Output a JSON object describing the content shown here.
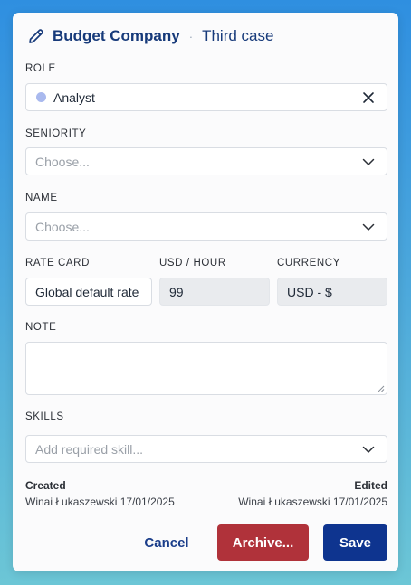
{
  "header": {
    "title": "Budget Company",
    "separator": "·",
    "subtitle": "Third case"
  },
  "role": {
    "label": "ROLE",
    "value": "Analyst",
    "dot_color": "#a9b9ee"
  },
  "seniority": {
    "label": "SENIORITY",
    "placeholder": "Choose..."
  },
  "name": {
    "label": "NAME",
    "placeholder": "Choose..."
  },
  "rate_card": {
    "label": "RATE CARD",
    "value": "Global default rate"
  },
  "usd_hour": {
    "label": "USD / HOUR",
    "value": "99"
  },
  "currency": {
    "label": "CURRENCY",
    "value": "USD - $"
  },
  "note": {
    "label": "NOTE",
    "value": ""
  },
  "skills": {
    "label": "SKILLS",
    "placeholder": "Add required skill..."
  },
  "meta": {
    "created_label": "Created",
    "created_value": "Winai Łukaszewski 17/01/2025",
    "edited_label": "Edited",
    "edited_value": "Winai Łukaszewski 17/01/2025"
  },
  "actions": {
    "cancel": "Cancel",
    "archive": "Archive...",
    "save": "Save"
  },
  "colors": {
    "primary": "#0e348f",
    "danger": "#b0323a",
    "heading": "#173a7a"
  }
}
